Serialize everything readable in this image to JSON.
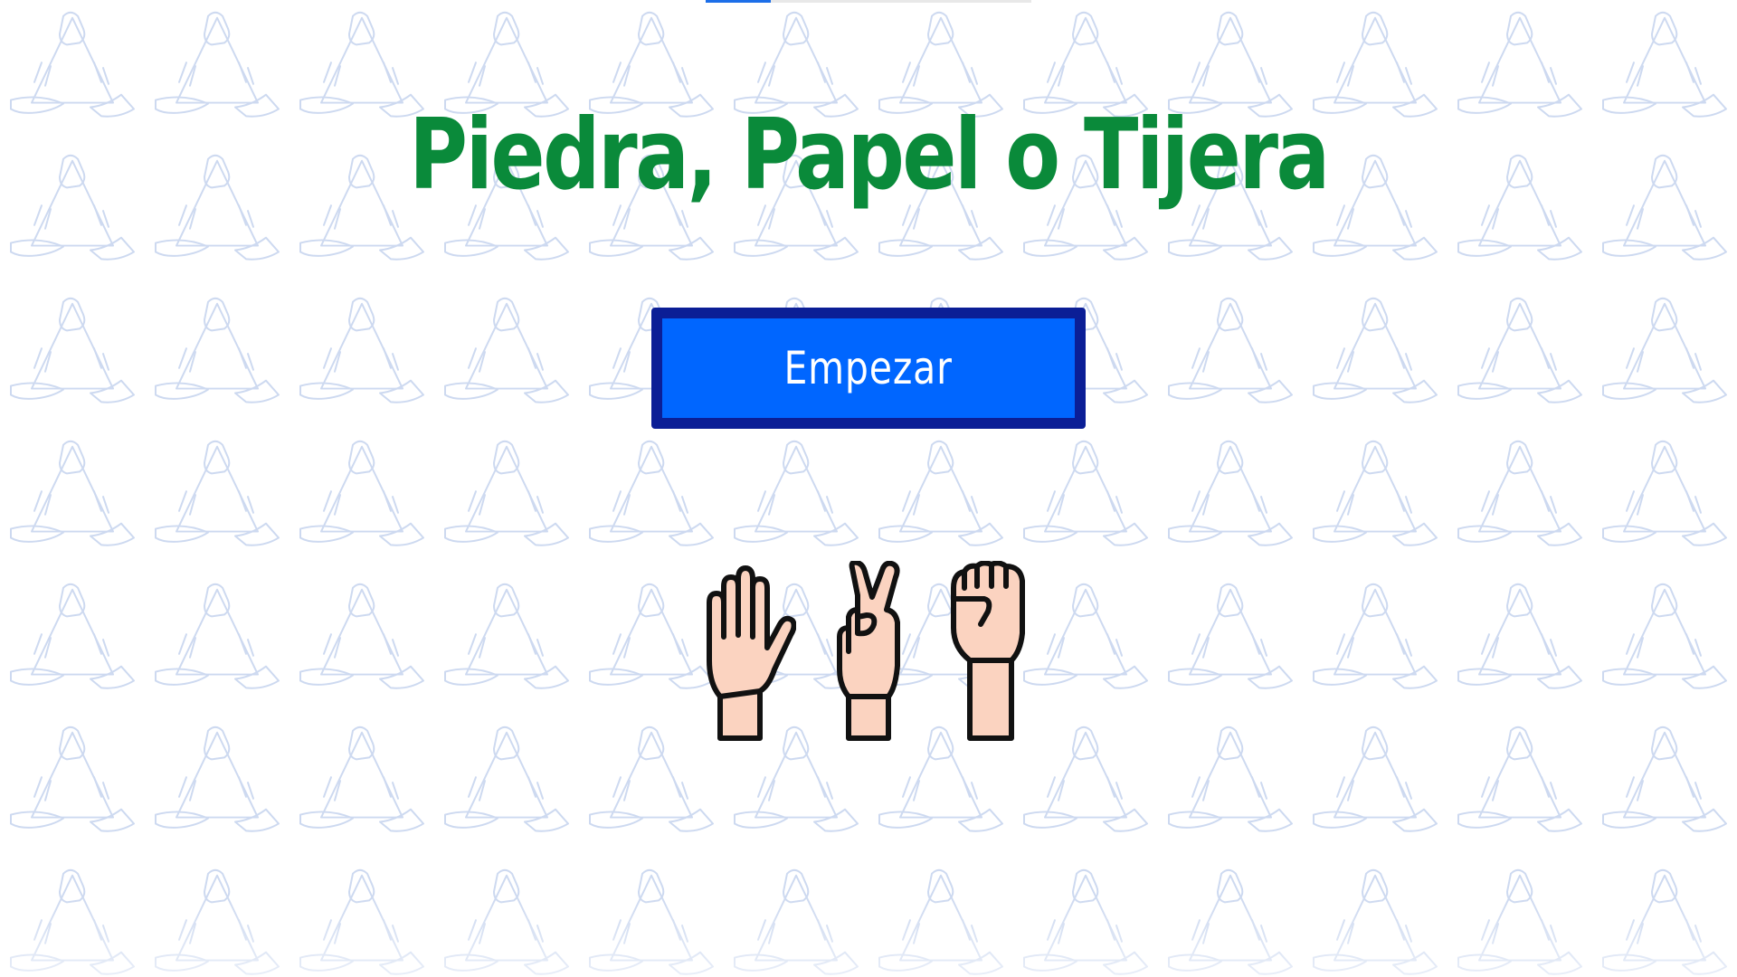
{
  "game": {
    "title": "Piedra, Papel o Tijera",
    "start_label": "Empezar"
  },
  "choices": [
    {
      "name": "papel",
      "icon": "open-hand-icon"
    },
    {
      "name": "tijera",
      "icon": "victory-hand-icon"
    },
    {
      "name": "piedra",
      "icon": "fist-icon"
    }
  ],
  "colors": {
    "title": "#0a8a3a",
    "button_fill": "#0066ff",
    "button_border": "#0b1e96",
    "button_text": "#ffffff",
    "skin": "#fbd3c0",
    "outline": "#111111"
  }
}
